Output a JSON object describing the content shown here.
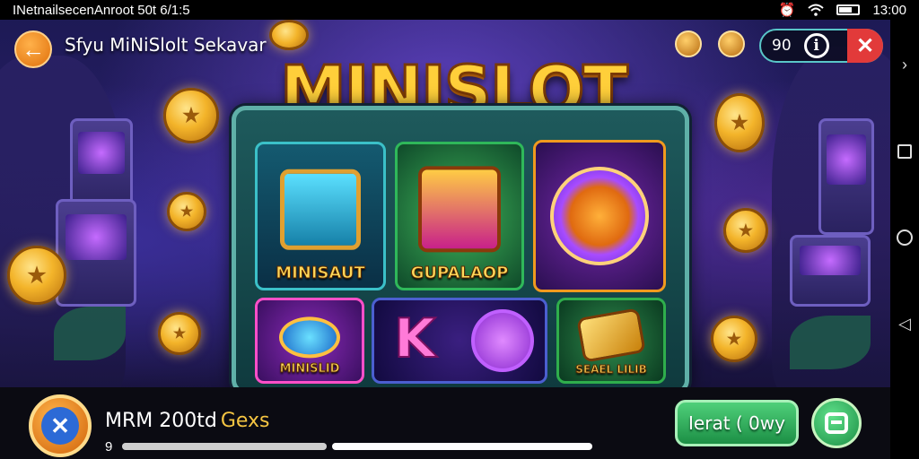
{
  "status_bar": {
    "left_text": "INetnailsecenAnroot 50t  6/1:5",
    "time": "13:00"
  },
  "header": {
    "back_icon": "arrow-left-icon",
    "title": "Sfyu MiNiSlolt Sekavar",
    "hud_value": "90",
    "info_label": "i",
    "close_label": "✕"
  },
  "logo": {
    "text": "MINISLOT"
  },
  "tiles": [
    {
      "label": "MINISAUT",
      "icon": "screen-machine-icon",
      "accent": "#2ac0d8"
    },
    {
      "label": "GUPALAOP",
      "icon": "treasure-chest-icon",
      "accent": "#3fe07a"
    },
    {
      "label": "",
      "icon": "gem-coin-icon",
      "accent": "#d35bff"
    },
    {
      "label": "MINISLID",
      "icon": "gem-button-icon",
      "accent": "#ff4fc8"
    },
    {
      "label": "K",
      "icon": "letter-k-icon",
      "accent": "#ff5bd8"
    },
    {
      "label": "",
      "icon": "swirl-orb-icon",
      "accent": "#b84bff"
    },
    {
      "label": "SEAEL LILIB",
      "icon": "gold-card-icon",
      "accent": "#2fae4c"
    }
  ],
  "player": {
    "name": "MRM 200td",
    "name_suffix": "Gexs",
    "level": "9",
    "progress": 1.0
  },
  "actions": {
    "play_label": "Ierat ( 0wy",
    "menu_icon": "menu-box-icon"
  },
  "colors": {
    "accent_orange": "#f39a1e",
    "accent_green": "#2fb85a",
    "close_red": "#e23a3a",
    "frame_teal": "#5fb0a8"
  }
}
